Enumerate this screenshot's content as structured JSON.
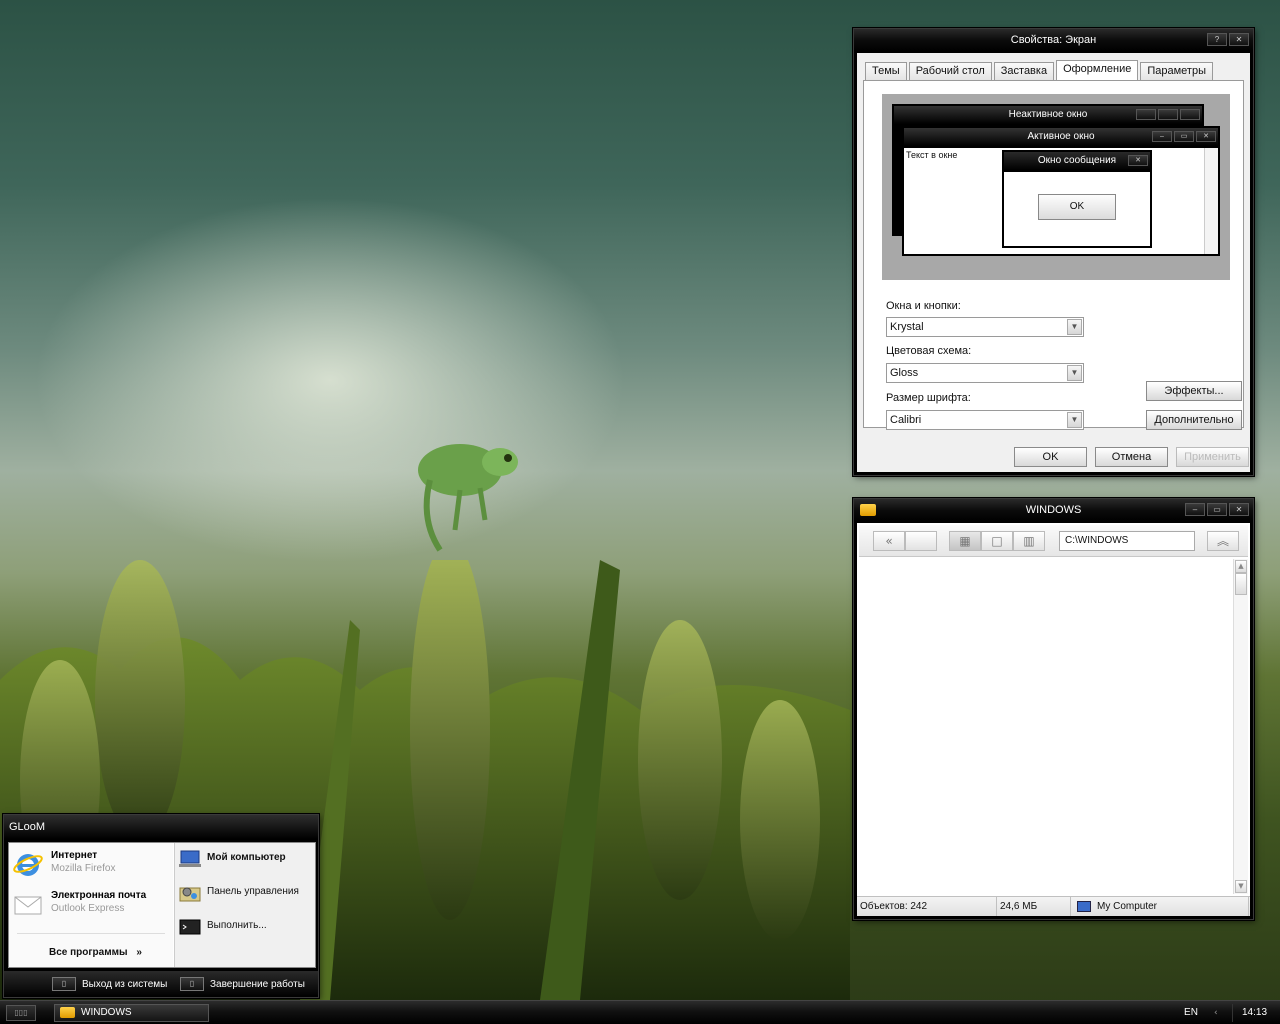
{
  "display_window": {
    "title": "Свойства: Экран",
    "tabs": [
      "Темы",
      "Рабочий стол",
      "Заставка",
      "Оформление",
      "Параметры"
    ],
    "active_tab": "Оформление",
    "preview": {
      "inactive_title": "Неактивное окно",
      "active_title": "Активное окно",
      "window_text": "Текст в окне",
      "message_title": "Окно сообщения",
      "ok_label": "OK"
    },
    "windows_buttons_label": "Окна и кнопки:",
    "windows_buttons_value": "Krystal",
    "color_scheme_label": "Цветовая схема:",
    "color_scheme_value": "Gloss",
    "font_size_label": "Размер шрифта:",
    "font_size_value": "Calibri",
    "effects_button": "Эффекты...",
    "advanced_button": "Дополнительно",
    "ok_button": "OK",
    "cancel_button": "Отмена",
    "apply_button": "Применить"
  },
  "explorer_window": {
    "title": "WINDOWS",
    "address": "C:\\WINDOWS",
    "status_objects": "Объектов: 242",
    "status_size": "24,6 МБ",
    "status_location": "My Computer"
  },
  "start_menu": {
    "user": "GLooM",
    "left_items": [
      {
        "title": "Интернет",
        "subtitle": "Mozilla Firefox",
        "icon": "internet-explorer-icon"
      },
      {
        "title": "Электронная почта",
        "subtitle": "Outlook Express",
        "icon": "mail-icon"
      }
    ],
    "all_programs": "Все программы",
    "right_items": [
      {
        "label": "Мой компьютер",
        "icon": "my-computer-icon"
      },
      {
        "label": "Панель управления",
        "icon": "control-panel-icon"
      },
      {
        "label": "Выполнить...",
        "icon": "run-icon"
      }
    ],
    "logoff": "Выход из системы",
    "shutdown": "Завершение работы"
  },
  "taskbar": {
    "task_label": "WINDOWS",
    "language": "EN",
    "clock": "14:13"
  },
  "colors": {
    "chrome_black": "#000000",
    "window_face": "#f0f0f0",
    "folder_yellow": "#ffc21a"
  }
}
